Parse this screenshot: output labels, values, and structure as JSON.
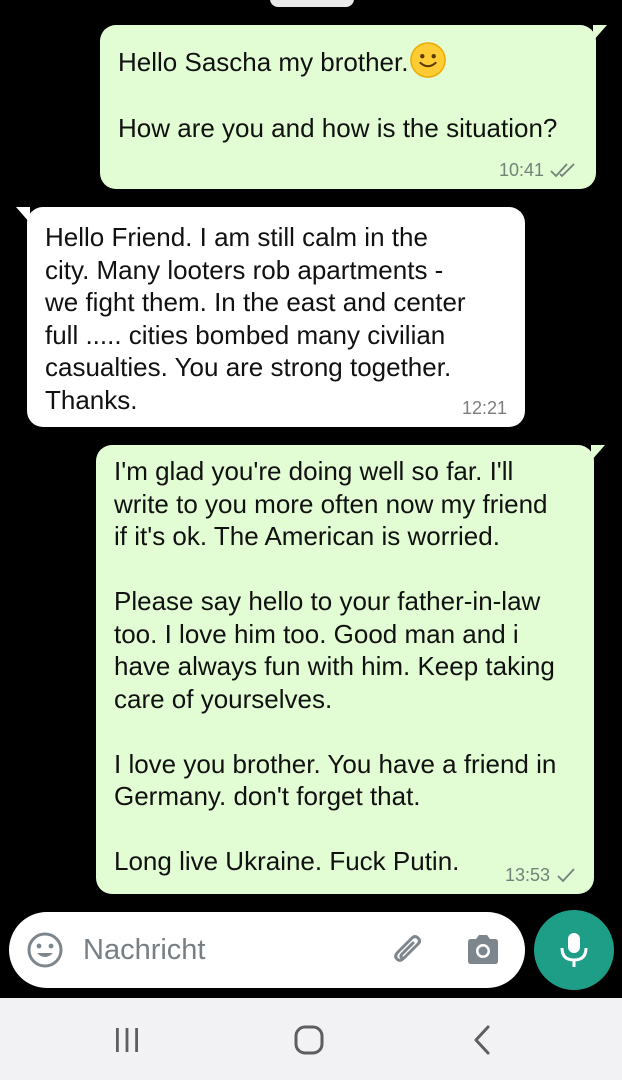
{
  "chat": {
    "messages": [
      {
        "direction": "outgoing",
        "paragraphs": [
          "Hello Sascha my brother.",
          "How are you and how is the situation?"
        ],
        "emoji": "slightly-smiling-face-emoji",
        "time": "10:41",
        "status": "read-double-check-icon"
      },
      {
        "direction": "incoming",
        "paragraphs": [
          "Hello Friend. I am still calm in the\ncity. Many looters rob apartments -\nwe fight them. In the east and center\nfull ..... cities bombed many civilian\ncasualties. You are strong together.\nThanks."
        ],
        "time": "12:21"
      },
      {
        "direction": "outgoing",
        "paragraphs": [
          "I'm glad you're doing well so far. I'll\nwrite to you more often now my friend\nif it's ok. The American is worried.",
          "Please say hello to your father-in-law\ntoo. I love him too. Good man and i\nhave always fun with him. Keep taking\ncare of yourselves.",
          "I love you brother. You have a friend in\nGermany. don't forget that.",
          "Long live Ukraine. Fuck Putin."
        ],
        "time": "13:53",
        "status": "sent-single-check-icon"
      }
    ]
  },
  "composer": {
    "placeholder": "Nachricht",
    "icons": [
      "smiley-emoji-icon",
      "paperclip-attach-icon",
      "camera-icon",
      "microphone-icon"
    ]
  },
  "nav": {
    "icons": [
      "recent-apps-icon",
      "home-icon",
      "back-icon"
    ]
  },
  "colors": {
    "background": "#000000",
    "outgoing_bubble": "#e2fdd4",
    "incoming_bubble": "#ffffff",
    "accent": "#1e9e87",
    "read_check": "#728279"
  }
}
